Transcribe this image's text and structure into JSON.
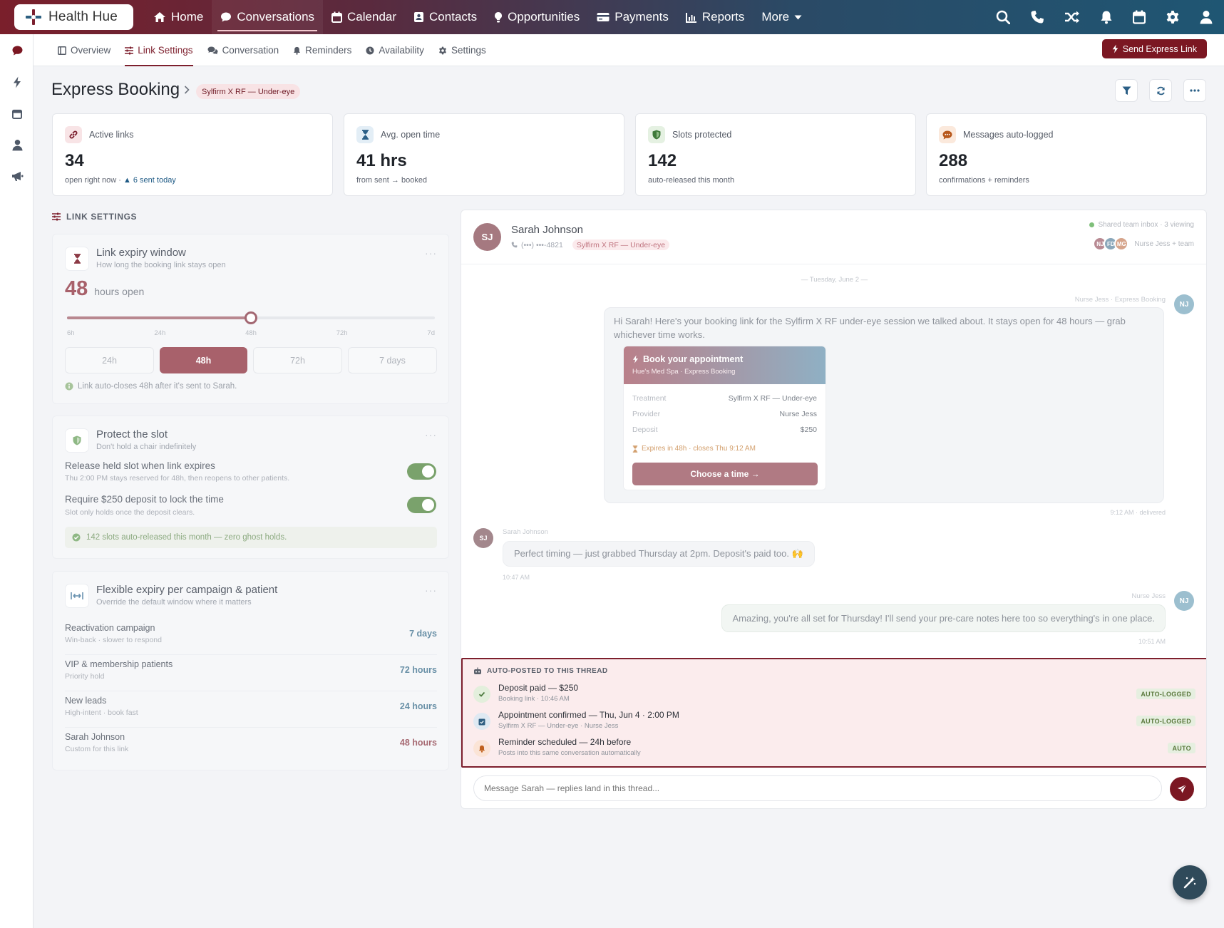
{
  "app": {
    "name": "Health Hue"
  },
  "nav": {
    "items": [
      {
        "label": "Home",
        "icon": "home-icon"
      },
      {
        "label": "Conversations",
        "icon": "chat-icon",
        "active": true
      },
      {
        "label": "Calendar",
        "icon": "calendar-icon"
      },
      {
        "label": "Contacts",
        "icon": "contact-card-icon"
      },
      {
        "label": "Opportunities",
        "icon": "lightbulb-icon"
      },
      {
        "label": "Payments",
        "icon": "credit-card-icon"
      },
      {
        "label": "Reports",
        "icon": "bar-chart-icon"
      },
      {
        "label": "More",
        "icon": "chevron-down-icon"
      }
    ],
    "right_icons": [
      "search-icon",
      "phone-icon",
      "shuffle-icon",
      "bell-icon",
      "calendar-icon",
      "gear-icon",
      "user-icon"
    ]
  },
  "rail": {
    "icons": [
      "chat-icon",
      "bolt-icon",
      "calendar-icon",
      "user-icon",
      "megaphone-icon"
    ]
  },
  "subnav": {
    "tabs": [
      {
        "label": "Overview",
        "icon": "layout-icon"
      },
      {
        "label": "Link Settings",
        "icon": "sliders-icon",
        "active": true
      },
      {
        "label": "Conversation",
        "icon": "chat-icon"
      },
      {
        "label": "Reminders",
        "icon": "bell-icon"
      },
      {
        "label": "Availability",
        "icon": "clock-icon"
      },
      {
        "label": "Settings",
        "icon": "gear-icon"
      }
    ],
    "send_label": "Send Express Link"
  },
  "header": {
    "title": "Express Booking",
    "pill": "Sylfirm X RF — Under-eye"
  },
  "stats": [
    {
      "label": "Active links",
      "value": "34",
      "sub": "open right now · ",
      "sub_highlight": "▲ 6 sent today",
      "icon": "link-icon",
      "color": "#7b1f2e",
      "bg": "#f8e4e6"
    },
    {
      "label": "Avg. open time",
      "value": "41 hrs",
      "sub": "from sent → booked",
      "sub_highlight": "",
      "icon": "hourglass-icon",
      "color": "#2b5f86",
      "bg": "#e3eef6"
    },
    {
      "label": "Slots protected",
      "value": "142",
      "sub": "auto-released this month",
      "sub_highlight": "",
      "icon": "shield-icon",
      "color": "#3f7a3a",
      "bg": "#e5f1e2"
    },
    {
      "label": "Messages auto-logged",
      "value": "288",
      "sub": "confirmations + reminders",
      "sub_highlight": "",
      "icon": "speech-icon",
      "color": "#b8581c",
      "bg": "#fbe9dc"
    }
  ],
  "link_settings": {
    "section_label": "LINK SETTINGS",
    "expiry": {
      "title": "Link expiry window",
      "subtitle": "How long the booking link stays open",
      "value": "48",
      "unit": "hours open",
      "slider_fraction": 0.5,
      "ticks": [
        "6h",
        "24h",
        "48h",
        "72h",
        "7d"
      ],
      "options": [
        "24h",
        "48h",
        "72h",
        "7 days"
      ],
      "selected": "48h",
      "note": "Link auto-closes 48h after it's sent to Sarah."
    },
    "protect": {
      "title": "Protect the slot",
      "subtitle": "Don't hold a chair indefinitely",
      "toggles": [
        {
          "label": "Release held slot when link expires",
          "desc": "Thu 2:00 PM stays reserved for 48h, then reopens to other patients.",
          "on": true
        },
        {
          "label": "Require $250 deposit to lock the time",
          "desc": "Slot only holds once the deposit clears.",
          "on": true
        }
      ],
      "banner": "142 slots auto-released this month — zero ghost holds."
    },
    "flexible": {
      "title": "Flexible expiry per campaign & patient",
      "subtitle": "Override the default window where it matters",
      "rows": [
        {
          "name": "Reactivation campaign",
          "desc": "Win-back · slower to respond",
          "value": "7 days",
          "color": "#3a6e8c"
        },
        {
          "name": "VIP & membership patients",
          "desc": "Priority hold",
          "value": "72 hours",
          "color": "#3a6e8c"
        },
        {
          "name": "New leads",
          "desc": "High-intent · book fast",
          "value": "24 hours",
          "color": "#3a6e8c"
        },
        {
          "name": "Sarah Johnson",
          "desc": "Custom for this link",
          "value": "48 hours",
          "color": "#8c3a45"
        }
      ]
    }
  },
  "chat": {
    "contact": {
      "initials": "SJ",
      "name": "Sarah Johnson",
      "phone": "(•••) •••-4821",
      "tag": "Sylfirm X RF — Under-eye"
    },
    "inbox": {
      "status": "Shared team inbox · 3 viewing",
      "avatars": [
        "NJ",
        "FD",
        "MG"
      ],
      "team": "Nurse Jess + team"
    },
    "date_sep": "— Tuesday, June 2 —",
    "msg1": {
      "sender": "Nurse Jess · Express Booking",
      "initials": "NJ",
      "text": "Hi Sarah! Here's your booking link for the Sylfirm X RF under-eye session we talked about. It stays open for 48 hours — grab whichever time works.",
      "time": "9:12 AM · delivered",
      "card": {
        "title": "Book your appointment",
        "subtitle": "Hue's Med Spa · Express Booking",
        "rows": [
          {
            "k": "Treatment",
            "v": "Sylfirm X RF — Under-eye"
          },
          {
            "k": "Provider",
            "v": "Nurse Jess"
          },
          {
            "k": "Deposit",
            "v": "$250"
          }
        ],
        "expires": "Expires in 48h · closes Thu 9:12 AM",
        "cta": "Choose a time →"
      }
    },
    "msg2": {
      "sender": "Sarah Johnson",
      "initials": "SJ",
      "text": "Perfect timing — just grabbed Thursday at 2pm. Deposit's paid too. 🙌",
      "time": "10:47 AM"
    },
    "msg3": {
      "sender": "Nurse Jess",
      "initials": "NJ",
      "text": "Amazing, you're all set for Thursday! I'll send your pre-care notes here too so everything's in one place.",
      "time": "10:51 AM"
    },
    "auto": {
      "heading": "AUTO-POSTED TO THIS THREAD",
      "items": [
        {
          "title": "Deposit paid — $250",
          "sub": "Booking link · 10:46 AM",
          "badge": "AUTO-LOGGED",
          "icon": "check-icon",
          "color": "#4c7a3e",
          "bg": "#e3efdc"
        },
        {
          "title": "Appointment confirmed — Thu, Jun 4 · 2:00 PM",
          "sub": "Sylfirm X RF — Under-eye · Nurse Jess",
          "badge": "AUTO-LOGGED",
          "icon": "calendar-check-icon",
          "color": "#2f5f82",
          "bg": "#dfe9f2"
        },
        {
          "title": "Reminder scheduled — 24h before",
          "sub": "Posts into this same conversation automatically",
          "badge": "AUTO",
          "icon": "bell-icon",
          "color": "#c0601c",
          "bg": "#fbe4d6"
        }
      ]
    },
    "composer_placeholder": "Message Sarah — replies land in this thread..."
  }
}
